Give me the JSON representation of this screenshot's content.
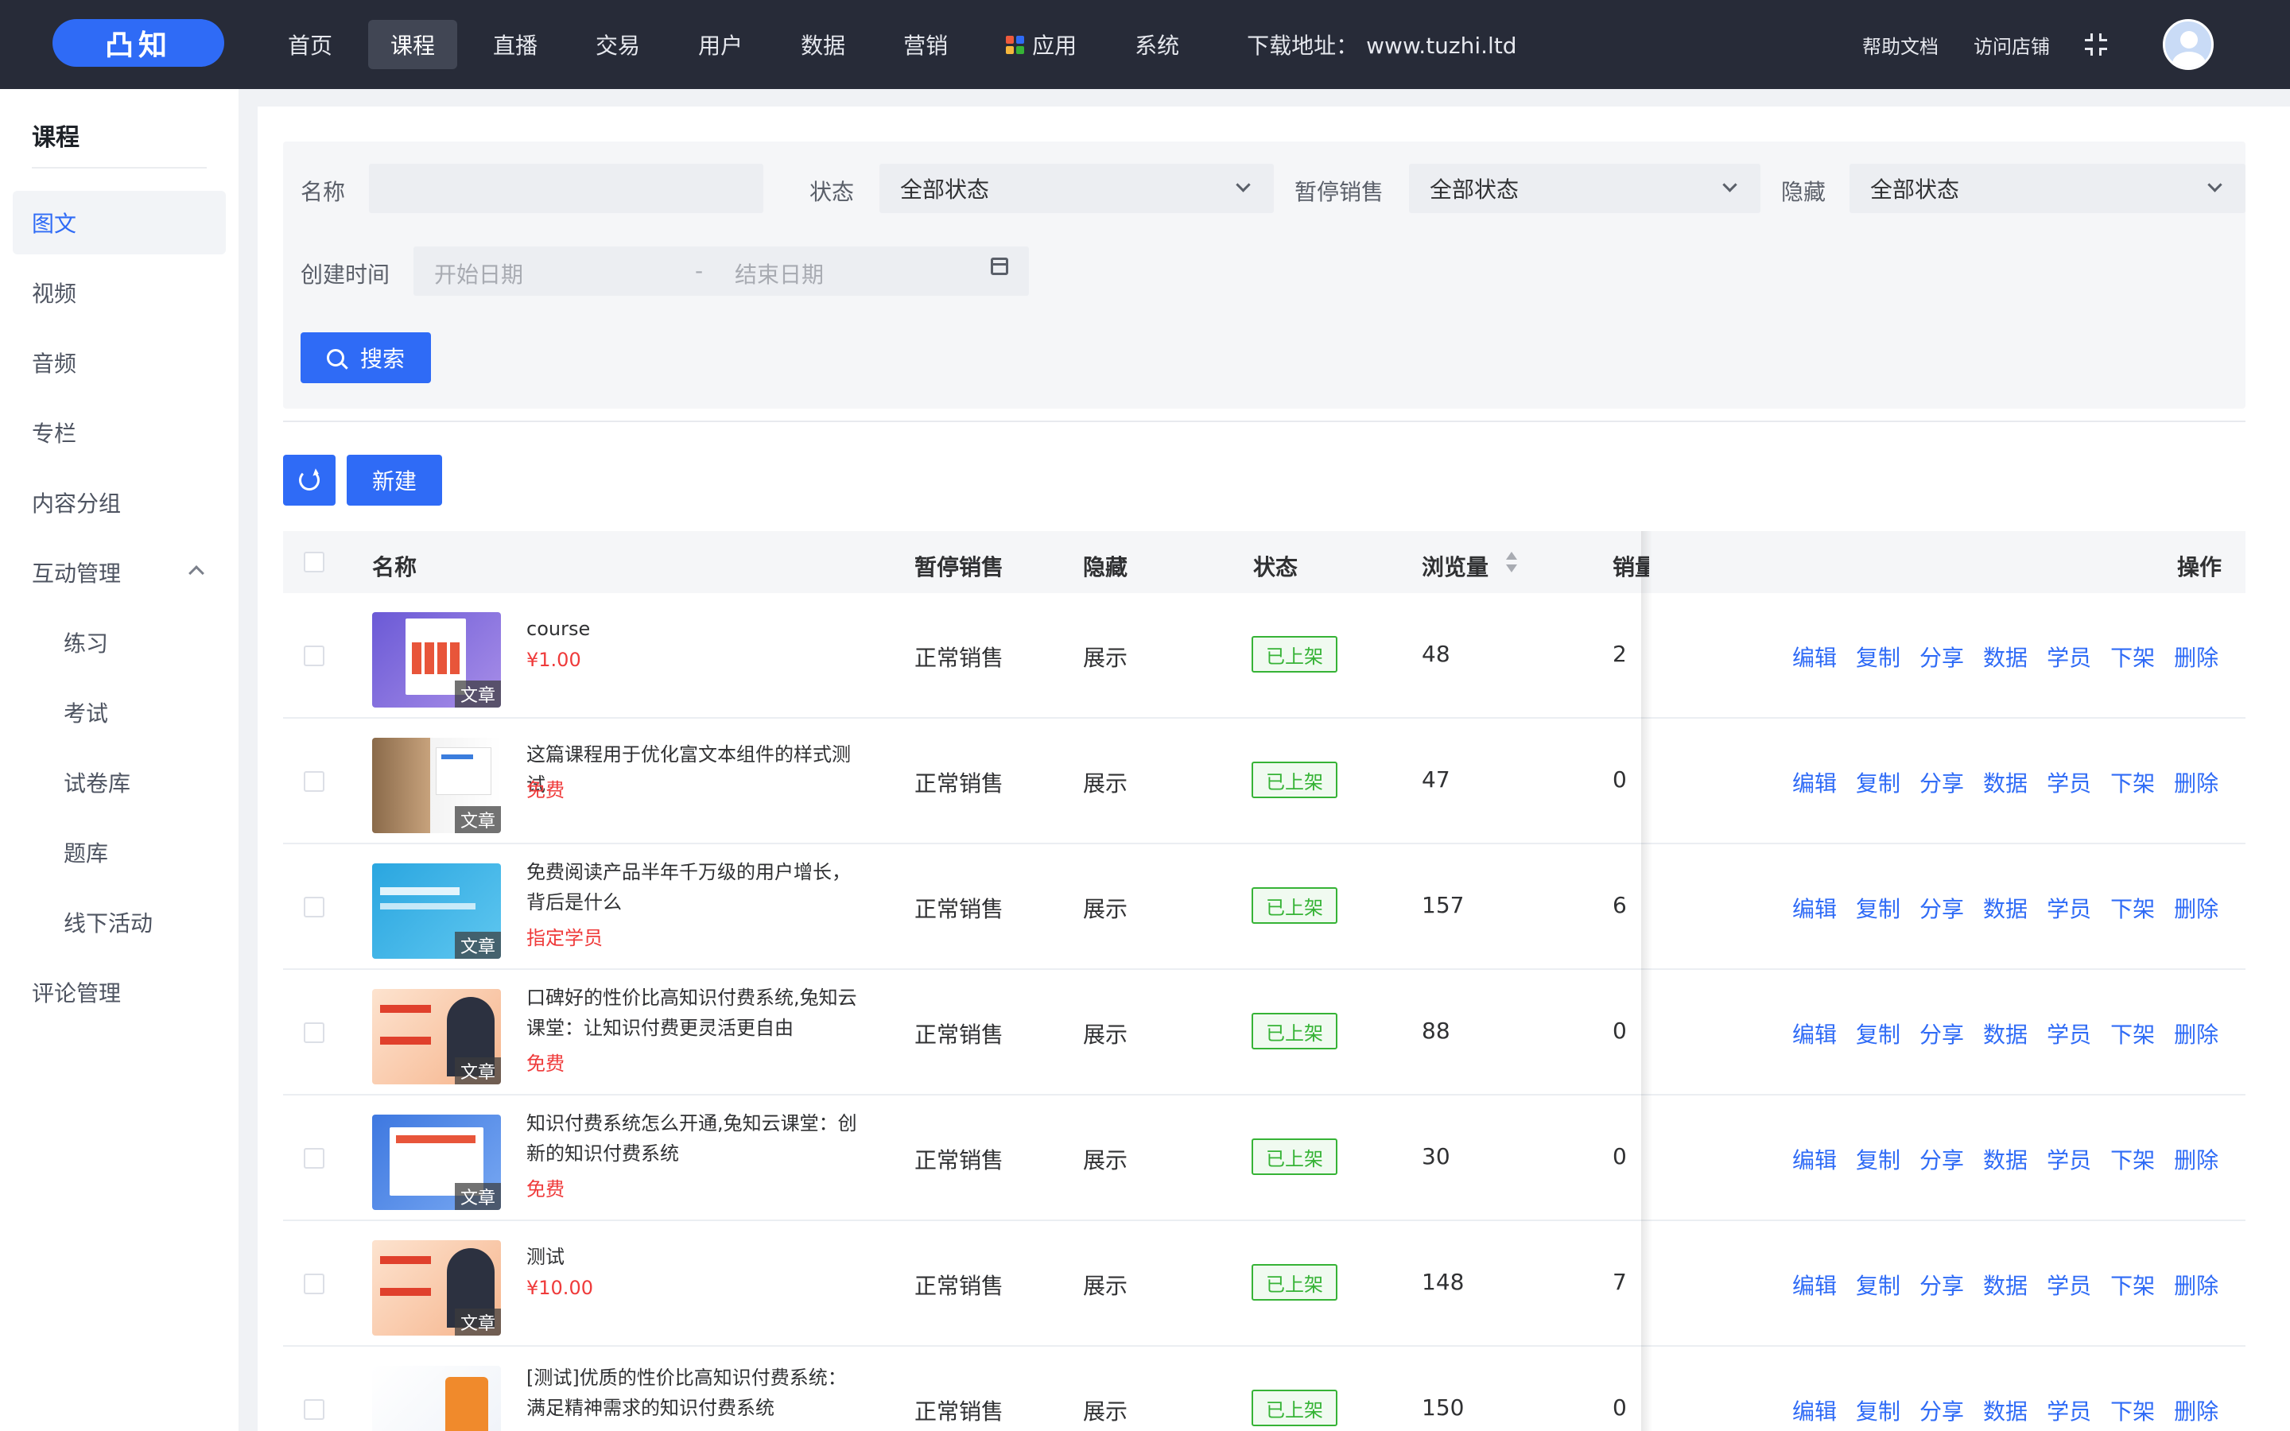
{
  "brand": {
    "logo": "凸知"
  },
  "nav": {
    "items": [
      "首页",
      "课程",
      "直播",
      "交易",
      "用户",
      "数据",
      "营销",
      "应用",
      "系统"
    ],
    "download_label": "下载地址：",
    "download_url": "www.tuzhi.ltd",
    "help": "帮助文档",
    "visit_store": "访问店铺"
  },
  "sidebar": {
    "title": "课程",
    "items": [
      "图文",
      "视频",
      "音频",
      "专栏",
      "内容分组",
      "互动管理"
    ],
    "sub_items": [
      "练习",
      "考试",
      "试卷库",
      "题库",
      "线下活动"
    ],
    "last_item": "评论管理"
  },
  "filter": {
    "name_label": "名称",
    "name_value": "",
    "status_label": "状态",
    "status_value": "全部状态",
    "pause_label": "暂停销售",
    "pause_value": "全部状态",
    "hidden_label": "隐藏",
    "hidden_value": "全部状态",
    "created_label": "创建时间",
    "start_placeholder": "开始日期",
    "range_sep": "-",
    "end_placeholder": "结束日期",
    "search_button": "搜索"
  },
  "toolbar": {
    "new_button": "新建"
  },
  "table": {
    "headers": {
      "name": "名称",
      "pause": "暂停销售",
      "hidden": "隐藏",
      "status": "状态",
      "views": "浏览量",
      "sales": "销量",
      "actions": "操作"
    },
    "action_labels": [
      "编辑",
      "复制",
      "分享",
      "数据",
      "学员",
      "下架",
      "删除"
    ],
    "thumb_tag": "文章",
    "rows": [
      {
        "title": "course",
        "price": "¥1.00",
        "pause": "正常销售",
        "hidden": "展示",
        "status": "已上架",
        "views": "48",
        "sales": "2"
      },
      {
        "title": "这篇课程用于优化富文本组件的样式测试",
        "price": "免费",
        "pause": "正常销售",
        "hidden": "展示",
        "status": "已上架",
        "views": "47",
        "sales": "0"
      },
      {
        "title": "免费阅读产品半年千万级的用户增长，背后是什么",
        "price": "指定学员",
        "pause": "正常销售",
        "hidden": "展示",
        "status": "已上架",
        "views": "157",
        "sales": "6"
      },
      {
        "title": "口碑好的性价比高知识付费系统,兔知云课堂：让知识付费更灵活更自由",
        "price": "免费",
        "pause": "正常销售",
        "hidden": "展示",
        "status": "已上架",
        "views": "88",
        "sales": "0"
      },
      {
        "title": "知识付费系统怎么开通,兔知云课堂：创新的知识付费系统",
        "price": "免费",
        "pause": "正常销售",
        "hidden": "展示",
        "status": "已上架",
        "views": "30",
        "sales": "0"
      },
      {
        "title": "测试",
        "price": "¥10.00",
        "pause": "正常销售",
        "hidden": "展示",
        "status": "已上架",
        "views": "148",
        "sales": "7"
      },
      {
        "title": "[测试]优质的性价比高知识付费系统：满足精神需求的知识付费系统",
        "price": "",
        "pause": "正常销售",
        "hidden": "展示",
        "status": "已上架",
        "views": "150",
        "sales": "0"
      }
    ]
  },
  "colors": {
    "accent": "#2f6bf6",
    "topbar": "#272b38",
    "price": "#ef3b3b",
    "status_green": "#36b336"
  }
}
